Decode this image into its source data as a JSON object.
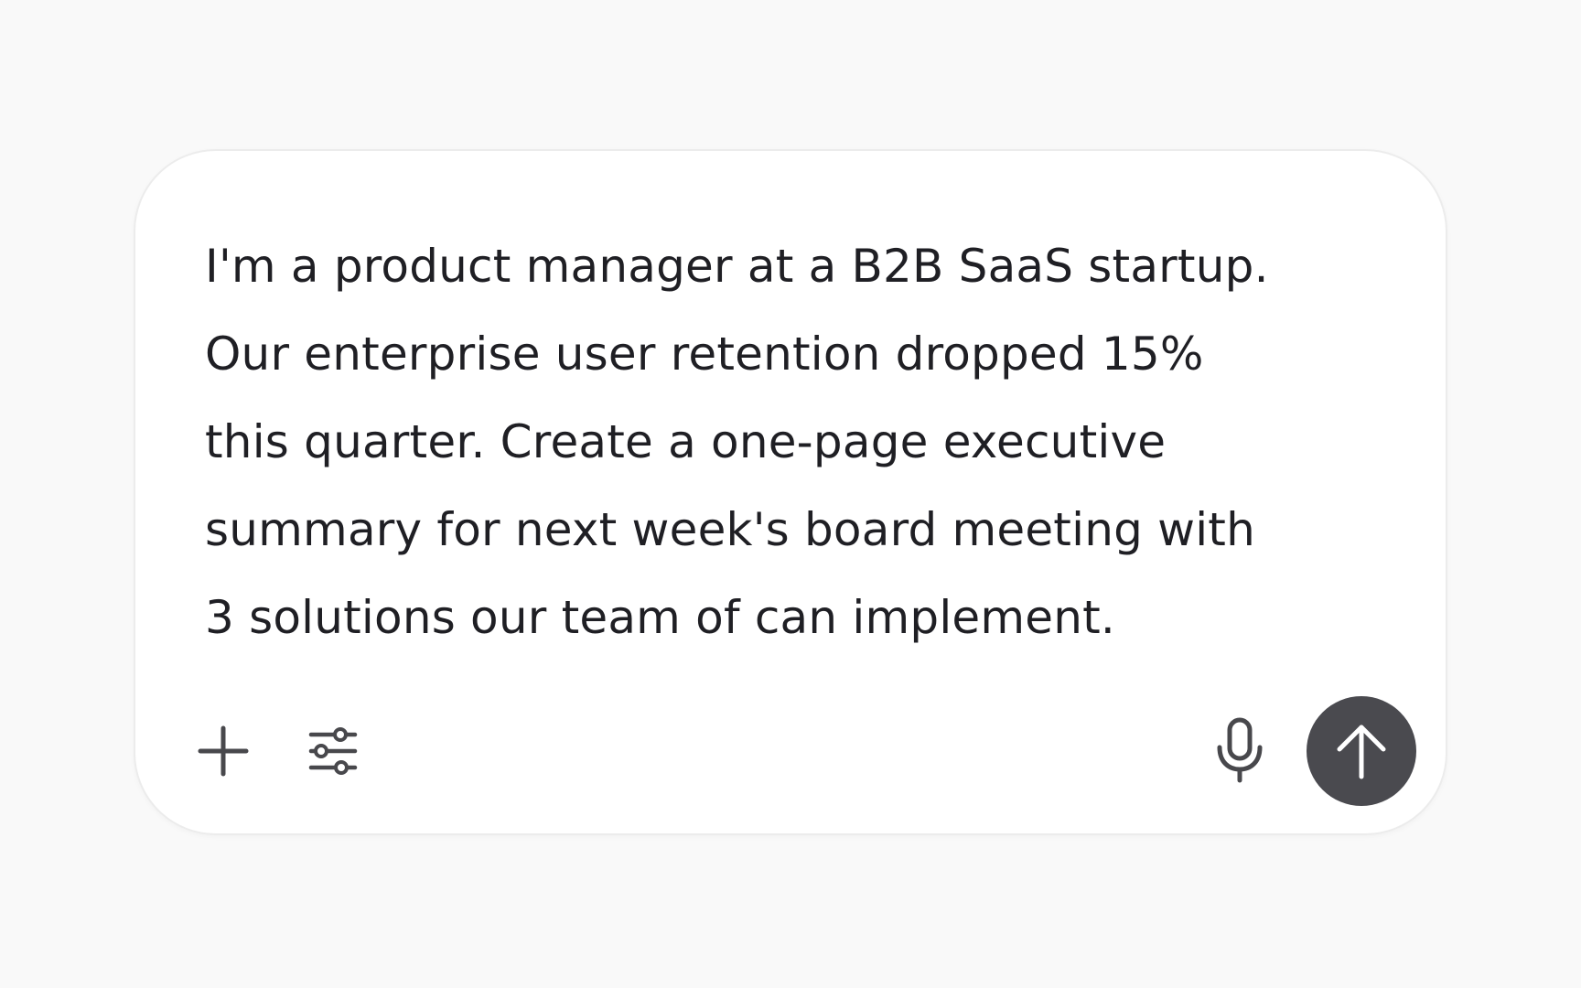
{
  "composer": {
    "prompt_text": "I'm a product manager at a B2B SaaS startup. Our enterprise user retention dropped 15% this quarter. Create a one-page executive summary for next week's board meeting with 3 solutions our team of can implement."
  },
  "toolbar": {
    "left_icons": [
      "plus-icon",
      "sliders-icon"
    ],
    "right_icons": [
      "microphone-icon",
      "arrow-up-icon"
    ]
  },
  "colors": {
    "background": "#f9f9f9",
    "card": "#ffffff",
    "text": "#1f1f24",
    "icon": "#48484c",
    "send_button": "#4a4a4f"
  }
}
